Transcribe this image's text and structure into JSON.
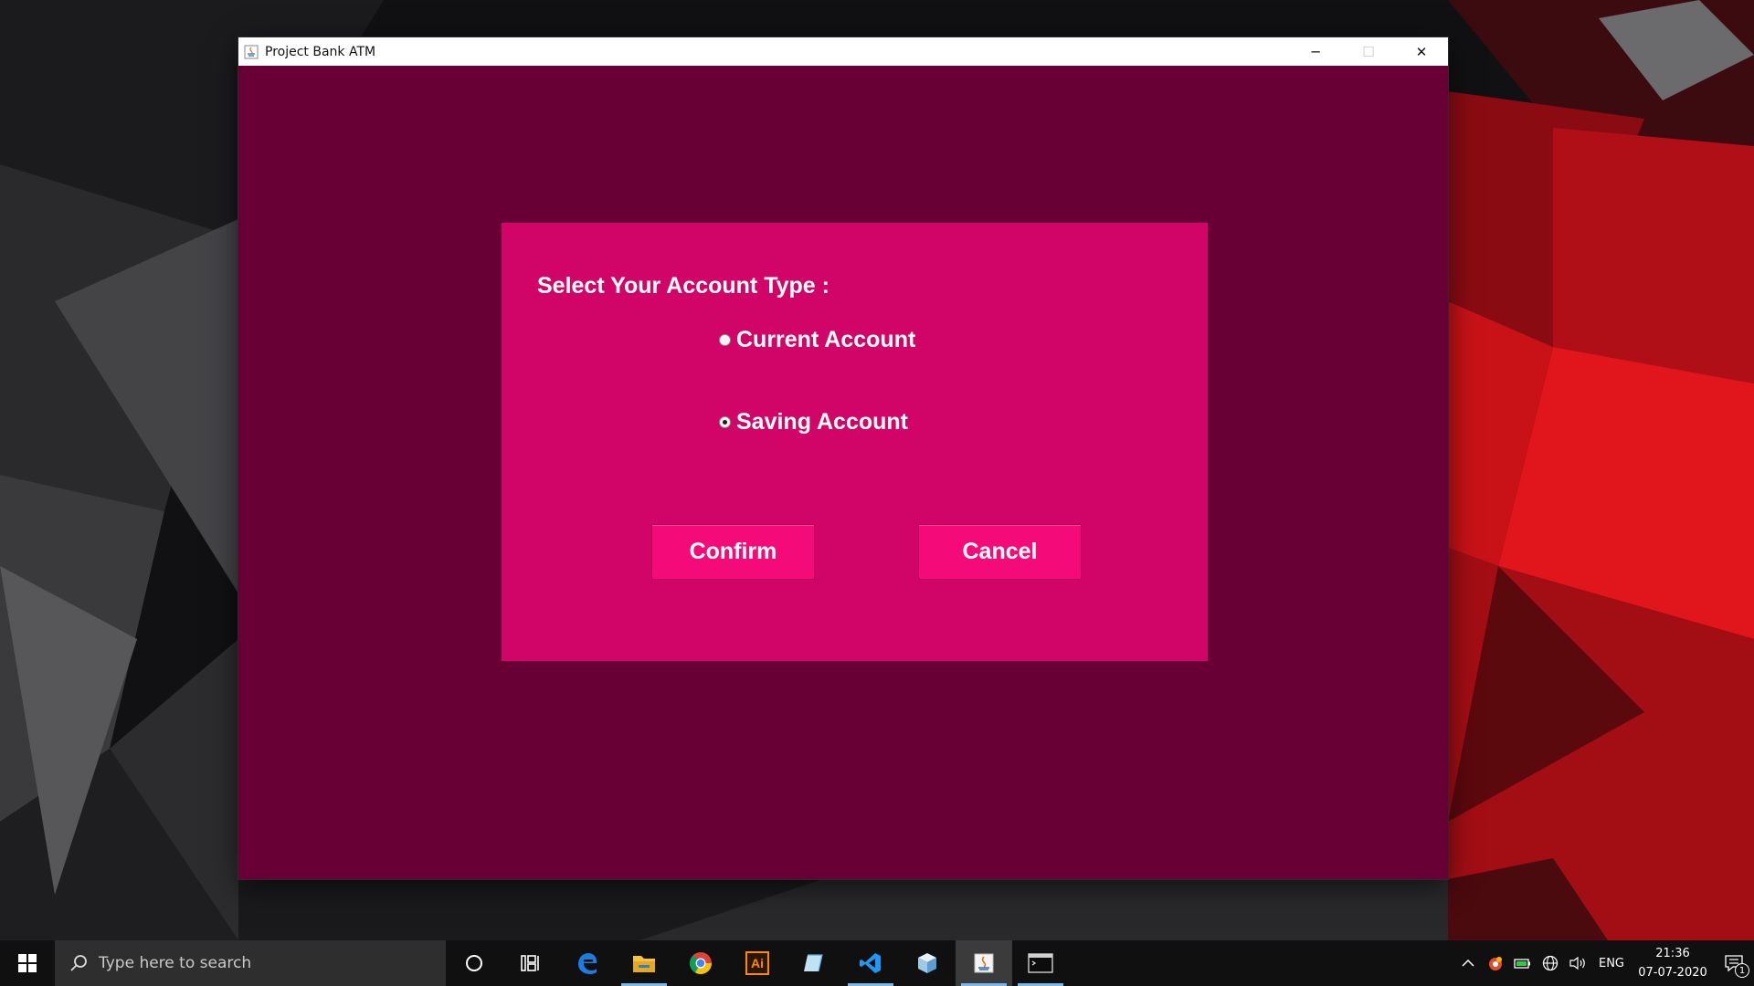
{
  "window": {
    "title": "Project Bank ATM",
    "minimize_glyph": "─",
    "maximize_glyph": "☐",
    "close_glyph": "✕"
  },
  "panel": {
    "heading": "Select Your Account Type :",
    "options": [
      {
        "label": "Current Account",
        "selected": false
      },
      {
        "label": "Saving Account",
        "selected": true
      }
    ],
    "confirm_label": "Confirm",
    "cancel_label": "Cancel"
  },
  "taskbar": {
    "search_placeholder": "Type here to search",
    "pinned_icons": [
      "cortana-icon",
      "task-view-icon",
      "edge-icon",
      "file-explorer-icon",
      "chrome-icon",
      "illustrator-icon",
      "notepad-icon",
      "vscode-icon",
      "3d-viewer-icon",
      "java-icon",
      "terminal-icon"
    ],
    "illustrator_text": "Ai",
    "tray": {
      "language": "ENG",
      "time": "21:36",
      "date": "07-07-2020",
      "notification_count": "1"
    }
  },
  "colors": {
    "window_bg": "#680035",
    "panel_bg": "#d10567",
    "button_bg": "#f40b79",
    "text": "#ffffff"
  }
}
